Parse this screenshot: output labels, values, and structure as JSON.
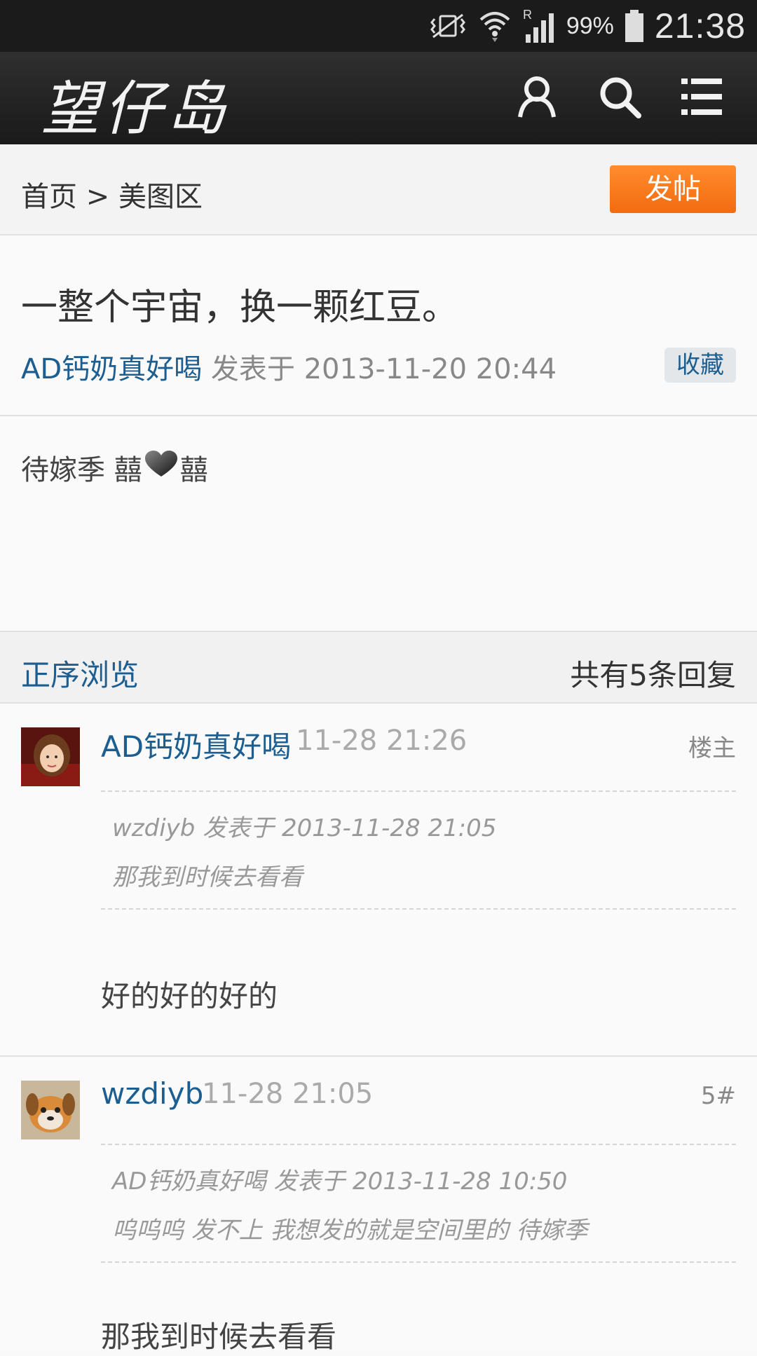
{
  "status_bar": {
    "battery": "99%",
    "time": "21:38",
    "icons": [
      "vibrate-icon",
      "wifi-icon",
      "signal-roaming-icon",
      "battery-icon"
    ]
  },
  "header": {
    "logo": "望仔岛",
    "icons": [
      "user-icon",
      "search-icon",
      "menu-icon"
    ]
  },
  "breadcrumb": {
    "text": "首页 > 美图区",
    "post_button": "发帖"
  },
  "thread": {
    "title": "一整个宇宙，换一颗红豆。",
    "author": "AD钙奶真好喝",
    "posted_prefix": " 发表于 ",
    "posted_time": "2013-11-20 20:44",
    "favorite_label": "收藏",
    "content_before": "待嫁季 囍",
    "content_after": "囍"
  },
  "reply_bar": {
    "sort_label": "正序浏览",
    "count_label": "共有5条回复"
  },
  "replies": [
    {
      "author": "AD钙奶真好喝",
      "time": "11-28 21:26",
      "floor": "楼主",
      "quote_header": "wzdiyb 发表于 2013-11-28 21:05",
      "quote_text": "那我到时候去看看",
      "text": "好的好的好的"
    },
    {
      "author": "wzdiyb",
      "time": "11-28 21:05",
      "floor": "5#",
      "quote_header": "AD钙奶真好喝 发表于 2013-11-28 10:50",
      "quote_text": "呜呜呜 发不上 我想发的就是空间里的   待嫁季",
      "text": "那我到时候去看看"
    }
  ],
  "colors": {
    "link_blue": "#1d5e91",
    "post_orange": "#f57a1c",
    "header_dark": "#222222"
  }
}
